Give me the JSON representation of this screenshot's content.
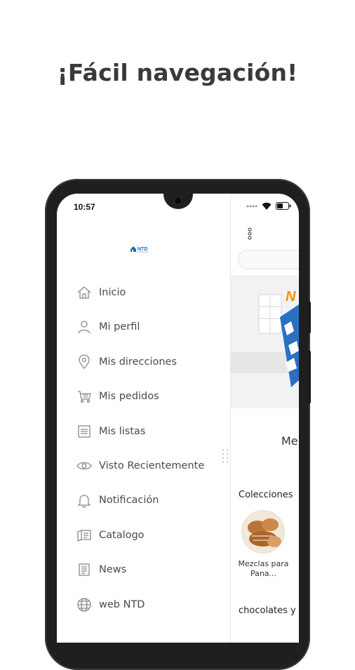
{
  "headline": "¡Fácil navegación!",
  "status": {
    "time": "10:57"
  },
  "drawer": {
    "logo_text": "NTD",
    "items": [
      {
        "label": "Inicio",
        "icon": "home-icon"
      },
      {
        "label": "Mi perfil",
        "icon": "user-icon"
      },
      {
        "label": "Mis direcciones",
        "icon": "location-pin-icon"
      },
      {
        "label": "Mis pedidos",
        "icon": "cart-icon"
      },
      {
        "label": "Mis listas",
        "icon": "list-icon"
      },
      {
        "label": "Visto Recientemente",
        "icon": "eye-icon"
      },
      {
        "label": "Notificación",
        "icon": "bell-icon"
      },
      {
        "label": "Catalogo",
        "icon": "catalog-icon"
      },
      {
        "label": "News",
        "icon": "news-icon"
      },
      {
        "label": "web NTD",
        "icon": "globe-icon"
      }
    ]
  },
  "content": {
    "banner_brand": "N",
    "section_title": "Me",
    "collections_title": "Colecciones",
    "collection_card_label": "Mezclas para Pana...",
    "next_section_title": "chocolates y"
  },
  "colors": {
    "accent": "#f39100",
    "icon_gray": "#8a8a8a",
    "logo_blue": "#1f6fb5"
  }
}
